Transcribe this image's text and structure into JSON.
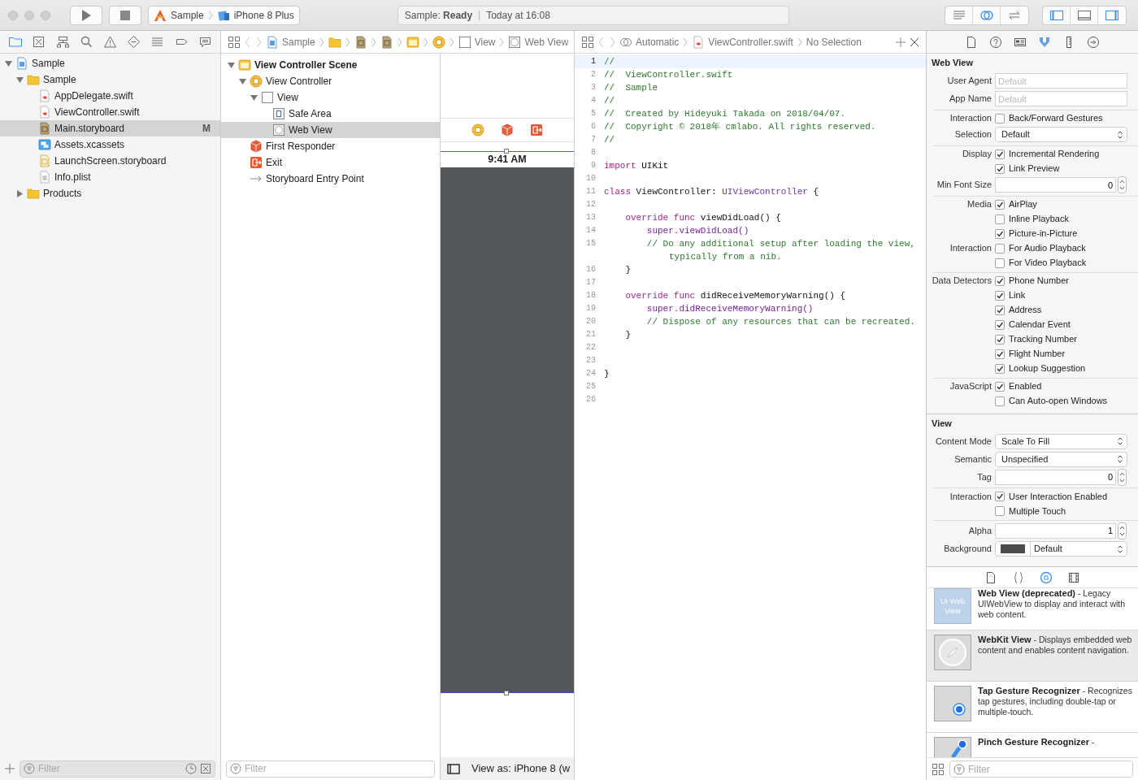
{
  "toolbar": {
    "scheme": {
      "project": "Sample",
      "device": "iPhone 8 Plus"
    },
    "status": {
      "message": "Sample: **Ready**",
      "time": "Today at 16:08"
    },
    "editor_modes": [
      {
        "selected": false
      },
      {
        "selected": true
      },
      {
        "selected": false
      }
    ],
    "panels": [
      {
        "on": true
      },
      {
        "on": false
      },
      {
        "on": true
      }
    ]
  },
  "navigator": {
    "tabs": [
      {
        "selected": true
      },
      {
        "selected": false
      },
      {
        "selected": false
      },
      {
        "selected": false
      },
      {
        "selected": false
      },
      {
        "selected": false
      },
      {
        "selected": false
      },
      {
        "selected": false
      },
      {
        "selected": false
      }
    ],
    "tree": [
      {
        "label": "Sample",
        "kind": "project",
        "expanded": true,
        "selected": false,
        "children": [
          {
            "label": "Sample",
            "kind": "folder",
            "expanded": true,
            "selected": false,
            "children": [
              {
                "label": "AppDelegate.swift",
                "kind": "swift",
                "selected": false
              },
              {
                "label": "ViewController.swift",
                "kind": "swift",
                "selected": false
              },
              {
                "label": "Main.storyboard",
                "kind": "storyboard",
                "selected": true,
                "badge": "M"
              },
              {
                "label": "Assets.xcassets",
                "kind": "assets",
                "selected": false
              },
              {
                "label": "LaunchScreen.storyboard",
                "kind": "launchscreen",
                "selected": false
              },
              {
                "label": "Info.plist",
                "kind": "plist",
                "selected": false
              }
            ]
          },
          {
            "label": "Products",
            "kind": "folder",
            "expanded": false,
            "selected": false
          }
        ]
      }
    ],
    "filter": {
      "placeholder": "Filter"
    }
  },
  "storyboard": {
    "jump_bar": [
      {
        "kind": "project",
        "label": "Sample"
      },
      {
        "kind": "folder"
      },
      {
        "kind": "storyboard"
      },
      {
        "kind": "storyboard"
      },
      {
        "kind": "scene"
      },
      {
        "kind": "controller"
      },
      {
        "kind": "view",
        "label": "View"
      },
      {
        "kind": "webview",
        "label": "Web View"
      }
    ],
    "outline": [
      {
        "label": "View Controller Scene",
        "kind": "scene",
        "expanded": true,
        "selected": false,
        "children": [
          {
            "label": "View Controller",
            "kind": "controller",
            "expanded": true,
            "selected": false,
            "children": [
              {
                "label": "View",
                "kind": "view",
                "expanded": true,
                "selected": false,
                "children": [
                  {
                    "label": "Safe Area",
                    "kind": "safearea",
                    "selected": false
                  },
                  {
                    "label": "Web View",
                    "kind": "webview",
                    "selected": true
                  }
                ]
              }
            ]
          },
          {
            "label": "First Responder",
            "kind": "responder",
            "selected": false
          },
          {
            "label": "Exit",
            "kind": "exit",
            "selected": false
          },
          {
            "label": "Storyboard Entry Point",
            "kind": "entry",
            "selected": false
          }
        ]
      }
    ],
    "outline_filter": {
      "placeholder": "Filter"
    },
    "canvas": {
      "status_time": "9:41 AM",
      "view_as": "View as: iPhone 8 (w"
    }
  },
  "editor": {
    "jump_bar": [
      {
        "kind": "assistant",
        "label": "Automatic"
      },
      {
        "kind": "swift",
        "label": "ViewController.swift"
      },
      {
        "label": "No Selection"
      }
    ],
    "lines": [
      {
        "number": "1",
        "current": true,
        "tokens": [
          {
            "kind": "comment",
            "text": "//"
          }
        ]
      },
      {
        "number": "2",
        "current": false,
        "tokens": [
          {
            "kind": "comment",
            "text": "//  ViewController.swift"
          }
        ]
      },
      {
        "number": "3",
        "current": false,
        "tokens": [
          {
            "kind": "comment",
            "text": "//  Sample"
          }
        ]
      },
      {
        "number": "4",
        "current": false,
        "tokens": [
          {
            "kind": "comment",
            "text": "//"
          }
        ]
      },
      {
        "number": "5",
        "current": false,
        "tokens": [
          {
            "kind": "comment",
            "text": "//  Created by Hideyuki Takada on 2018/04/07."
          }
        ]
      },
      {
        "number": "6",
        "current": false,
        "tokens": [
          {
            "kind": "comment",
            "text": "//  Copyright © 2018年 cmlabo. All rights reserved."
          }
        ]
      },
      {
        "number": "7",
        "current": false,
        "tokens": [
          {
            "kind": "comment",
            "text": "//"
          }
        ]
      },
      {
        "number": "8",
        "current": false
      },
      {
        "number": "9",
        "current": false,
        "tokens": [
          {
            "kind": "keyword",
            "text": "import"
          },
          {
            "kind": "plain",
            "text": " UIKit"
          }
        ]
      },
      {
        "number": "10",
        "current": false
      },
      {
        "number": "11",
        "current": false,
        "tokens": [
          {
            "kind": "keyword",
            "text": "class"
          },
          {
            "kind": "plain",
            "text": " ViewController: "
          },
          {
            "kind": "type",
            "text": "UIViewController"
          },
          {
            "kind": "plain",
            "text": " {"
          }
        ]
      },
      {
        "number": "12",
        "current": false
      },
      {
        "number": "13",
        "current": false,
        "tokens": [
          {
            "kind": "keyword",
            "text": "    override func"
          },
          {
            "kind": "plain",
            "text": " viewDidLoad() {"
          }
        ]
      },
      {
        "number": "14",
        "current": false,
        "tokens": [
          {
            "kind": "call",
            "text": "        super.viewDidLoad()"
          }
        ]
      },
      {
        "number": "15",
        "current": false,
        "tokens": [
          {
            "kind": "comment",
            "text": "        // Do any additional setup after loading the view, typically from a nib."
          }
        ]
      },
      {
        "number": "16",
        "current": false,
        "tokens": [
          {
            "kind": "plain",
            "text": "    }"
          }
        ]
      },
      {
        "number": "17",
        "current": false
      },
      {
        "number": "18",
        "current": false,
        "tokens": [
          {
            "kind": "keyword",
            "text": "    override func"
          },
          {
            "kind": "plain",
            "text": " didReceiveMemoryWarning() {"
          }
        ]
      },
      {
        "number": "19",
        "current": false,
        "tokens": [
          {
            "kind": "call",
            "text": "        super.didReceiveMemoryWarning()"
          }
        ]
      },
      {
        "number": "20",
        "current": false,
        "tokens": [
          {
            "kind": "comment",
            "text": "        // Dispose of any resources that can be recreated."
          }
        ]
      },
      {
        "number": "21",
        "current": false,
        "tokens": [
          {
            "kind": "plain",
            "text": "    }"
          }
        ]
      },
      {
        "number": "22",
        "current": false
      },
      {
        "number": "23",
        "current": false
      },
      {
        "number": "24",
        "current": false,
        "tokens": [
          {
            "kind": "plain",
            "text": "}"
          }
        ]
      },
      {
        "number": "25",
        "current": false
      },
      {
        "number": "26",
        "current": false
      }
    ]
  },
  "inspector": {
    "tabs": [
      {
        "selected": false
      },
      {
        "selected": false
      },
      {
        "selected": false
      },
      {
        "selected": true
      },
      {
        "selected": false
      },
      {
        "selected": false
      }
    ],
    "sections": [
      {
        "title": "Web View",
        "groups": [
          {
            "rows": [
              {
                "kind": "text",
                "label": "User Agent",
                "placeholder": "Default"
              },
              {
                "kind": "text",
                "label": "App Name",
                "placeholder": "Default"
              }
            ]
          },
          {
            "rows": [
              {
                "kind": "check",
                "label": "Interaction",
                "text": "Back/Forward Gestures",
                "checked": false
              },
              {
                "kind": "select",
                "label": "Selection",
                "value": "Default"
              }
            ]
          },
          {
            "rows": [
              {
                "kind": "check",
                "label": "Display",
                "text": "Incremental Rendering",
                "checked": true
              },
              {
                "kind": "check",
                "text": "Link Preview",
                "checked": true
              },
              {
                "kind": "number",
                "label": "Min Font Size",
                "value": "0"
              }
            ]
          },
          {
            "rows": [
              {
                "kind": "check",
                "label": "Media",
                "text": "AirPlay",
                "checked": true
              },
              {
                "kind": "check",
                "text": "Inline Playback",
                "checked": false
              },
              {
                "kind": "check",
                "text": "Picture-in-Picture",
                "checked": true
              },
              {
                "kind": "check",
                "label": "Interaction",
                "text": "For Audio Playback",
                "checked": false
              },
              {
                "kind": "check",
                "text": "For Video Playback",
                "checked": false
              }
            ]
          },
          {
            "rows": [
              {
                "kind": "check",
                "label": "Data Detectors",
                "text": "Phone Number",
                "checked": true
              },
              {
                "kind": "check",
                "text": "Link",
                "checked": true
              },
              {
                "kind": "check",
                "text": "Address",
                "checked": true
              },
              {
                "kind": "check",
                "text": "Calendar Event",
                "checked": true
              },
              {
                "kind": "check",
                "text": "Tracking Number",
                "checked": true
              },
              {
                "kind": "check",
                "text": "Flight Number",
                "checked": true
              },
              {
                "kind": "check",
                "text": "Lookup Suggestion",
                "checked": true
              }
            ]
          },
          {
            "rows": [
              {
                "kind": "check",
                "label": "JavaScript",
                "text": "Enabled",
                "checked": true
              },
              {
                "kind": "check",
                "text": "Can Auto-open Windows",
                "checked": false
              }
            ]
          }
        ]
      },
      {
        "title": "View",
        "groups": [
          {
            "rows": [
              {
                "kind": "select",
                "label": "Content Mode",
                "value": "Scale To Fill"
              },
              {
                "kind": "select",
                "label": "Semantic",
                "value": "Unspecified"
              },
              {
                "kind": "number",
                "label": "Tag",
                "value": "0"
              }
            ]
          },
          {
            "rows": [
              {
                "kind": "check",
                "label": "Interaction",
                "text": "User Interaction Enabled",
                "checked": true
              },
              {
                "kind": "check",
                "text": "Multiple Touch",
                "checked": false
              }
            ]
          },
          {
            "rows": [
              {
                "kind": "number",
                "label": "Alpha",
                "value": "1"
              },
              {
                "kind": "color",
                "label": "Background",
                "color": "#4b4b4b",
                "value": "Default"
              }
            ]
          }
        ]
      }
    ],
    "library": {
      "tabs": [
        {
          "selected": false
        },
        {
          "selected": false
        },
        {
          "selected": true
        },
        {
          "selected": false
        }
      ],
      "items": [
        {
          "kind": "uiwebview",
          "icon_label": "UI Web View",
          "text": "**Web View (deprecated)** - Legacy UIWebView to display and interact with web content.",
          "selected": false
        },
        {
          "kind": "webkit",
          "text": "**WebKit View** - Displays embedded web content and enables content navigation.",
          "selected": true
        },
        {
          "kind": "tap",
          "text": "**Tap Gesture Recognizer** - Recognizes tap gestures, including double-tap or multiple-touch.",
          "selected": false
        },
        {
          "kind": "pinch",
          "text": "**Pinch Gesture Recognizer** -",
          "selected": false
        }
      ],
      "filter": {
        "placeholder": "Filter"
      }
    }
  }
}
